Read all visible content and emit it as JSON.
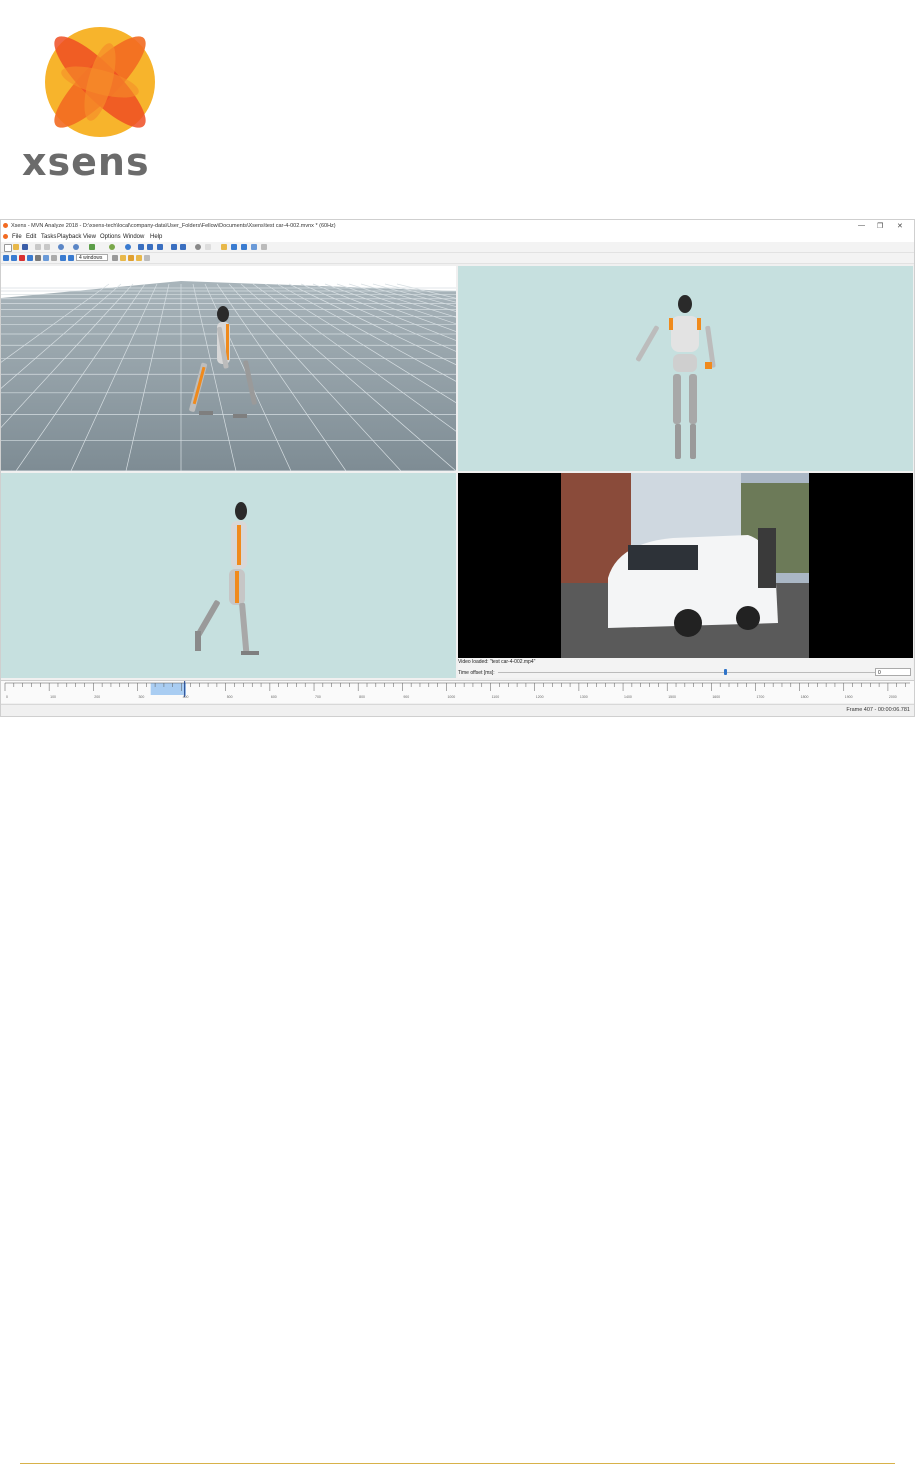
{
  "logo": {
    "text": "xsens",
    "colors": {
      "orange": "#f26a21",
      "yellow": "#f7b42c"
    }
  },
  "window": {
    "title": "Xsens - MVN Analyze 2018 - D:\\xsens-tech\\local\\company-data\\User_Folders\\Fellow\\Documents\\Xsens\\test car-4-002.mvnx * (60Hz)",
    "controls": {
      "minimize": "—",
      "restore": "❐",
      "close": "✕"
    }
  },
  "menu": [
    "File",
    "Edit",
    "Tasks",
    "Playback",
    "View",
    "Options",
    "Window",
    "Help"
  ],
  "toolbar": {
    "windows_select": "4 windows"
  },
  "views": {
    "perspective": {
      "icon": "avatar-3d-perspective"
    },
    "front": {
      "icon": "avatar-front"
    },
    "side": {
      "icon": "avatar-side"
    },
    "video": {
      "icon": "video-car-frame"
    }
  },
  "video_panel": {
    "loaded_label": "Video loaded: \"test car-4-002.mp4\"",
    "offset_label": "Time offset [ms]:",
    "offset_value": "0",
    "slider_fraction": 0.55
  },
  "timeline": {
    "tick_labels": [
      "0",
      "100",
      "200",
      "300",
      "400",
      "500",
      "600",
      "700",
      "800",
      "900",
      "1000",
      "1100",
      "1200",
      "1300",
      "1400",
      "1500",
      "1600",
      "1700",
      "1800",
      "1900",
      "2000"
    ],
    "selection_start": 330,
    "selection_end": 410,
    "cursor": 407
  },
  "status": {
    "frame_text": "Frame 407 - 00:00:06.781"
  },
  "colors": {
    "accent": "#f26a21",
    "viewport_bg": "#c6e0df",
    "floor": "#8e9ca4",
    "selection": "#a9cdf2",
    "footer_line": "#d8b24a"
  }
}
